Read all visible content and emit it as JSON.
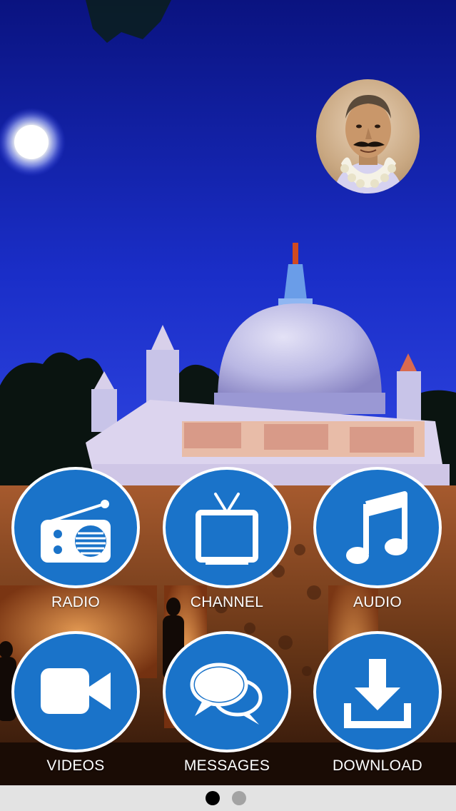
{
  "background": {
    "scene": "night-temple-dome-photo",
    "sky_color": "#1f2fd6"
  },
  "avatar": {
    "icon": "profile-portrait"
  },
  "menu": {
    "accent": "#1a73c9",
    "items": [
      {
        "label": "RADIO",
        "icon": "radio-icon"
      },
      {
        "label": "CHANNEL",
        "icon": "tv-icon"
      },
      {
        "label": "AUDIO",
        "icon": "music-note-icon"
      },
      {
        "label": "VIDEOS",
        "icon": "video-camera-icon"
      },
      {
        "label": "MESSAGES",
        "icon": "chat-bubbles-icon"
      },
      {
        "label": "DOWNLOAD",
        "icon": "download-icon"
      }
    ]
  },
  "pager": {
    "active_page": 1,
    "total_pages": 2
  }
}
